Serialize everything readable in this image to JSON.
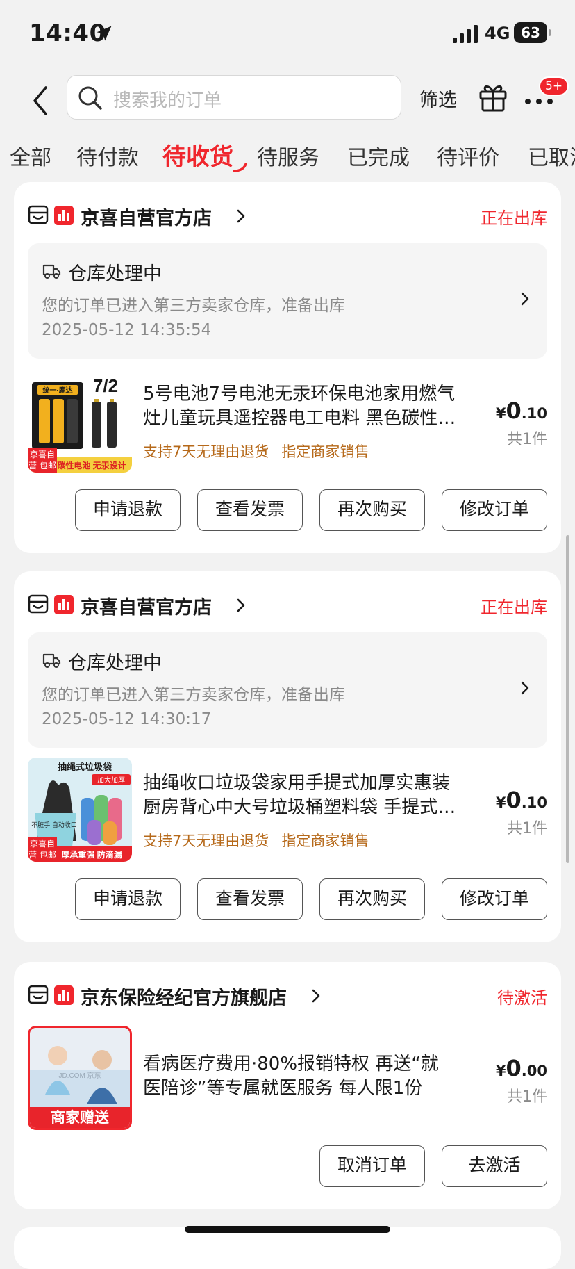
{
  "status_bar": {
    "time": "14:40",
    "network": "4G",
    "battery": "63"
  },
  "header": {
    "search_placeholder": "搜索我的订单",
    "filter_label": "筛选",
    "more_badge": "5+"
  },
  "tabs": [
    {
      "label": "全部"
    },
    {
      "label": "待付款"
    },
    {
      "label": "待收货",
      "active": true
    },
    {
      "label": "待服务"
    },
    {
      "label": "已完成"
    },
    {
      "label": "待评价"
    },
    {
      "label": "已取消"
    }
  ],
  "orders": [
    {
      "shop": "京喜自营官方店",
      "status": "正在出库",
      "logistics": {
        "title": "仓库处理中",
        "desc": "您的订单已进入第三方卖家仓库，准备出库",
        "time": "2025-05-12 14:35:54"
      },
      "product": {
        "title_line1": "5号电池7号电池无汞环保电池家用燃气",
        "title_line2": "灶儿童玩具遥控器电工电料 黑色碳性…",
        "tags": [
          "支持7天无理由退货",
          "指定商家销售"
        ],
        "price_symbol": "¥",
        "price_int": "0",
        "price_dec": ".10",
        "qty": "共1件",
        "image": {
          "brand_text": "统一·鹿达",
          "count_text": "7/2",
          "banner_text": "碳性电池 无汞设计",
          "free_tag": "京喜自营 包邮"
        }
      },
      "buttons": [
        "申请退款",
        "查看发票",
        "再次购买",
        "修改订单"
      ]
    },
    {
      "shop": "京喜自营官方店",
      "status": "正在出库",
      "logistics": {
        "title": "仓库处理中",
        "desc": "您的订单已进入第三方卖家仓库，准备出库",
        "time": "2025-05-12 14:30:17"
      },
      "product": {
        "title_line1": "抽绳收口垃圾袋家用手提式加厚实惠装",
        "title_line2": "厨房背心中大号垃圾桶塑料袋 手提式…",
        "tags": [
          "支持7天无理由退货",
          "指定商家销售"
        ],
        "price_symbol": "¥",
        "price_int": "0",
        "price_dec": ".10",
        "qty": "共1件",
        "image": {
          "top_text": "抽绳式垃圾袋",
          "tag_text": "加大加厚",
          "side_text": "不脏手 自动收口",
          "banner_text": "厚承重强 防滴漏",
          "free_tag": "京喜自营 包邮"
        }
      },
      "buttons": [
        "申请退款",
        "查看发票",
        "再次购买",
        "修改订单"
      ]
    },
    {
      "shop": "京东保险经纪官方旗舰店",
      "status": "待激活",
      "product": {
        "title_line1": "看病医疗费用·80%报销特权  再送“就",
        "title_line2": "医陪诊”等专属就医服务 每人限1份",
        "price_symbol": "¥",
        "price_int": "0",
        "price_dec": ".00",
        "qty": "共1件",
        "image": {
          "banner_text": "商家赠送",
          "watermark": "JD.COM 京东"
        }
      },
      "buttons": [
        "取消订单",
        "去激活"
      ]
    }
  ],
  "colors": {
    "accent": "#f0262d",
    "tag": "#b6691a",
    "bg": "#f2f2f2"
  }
}
